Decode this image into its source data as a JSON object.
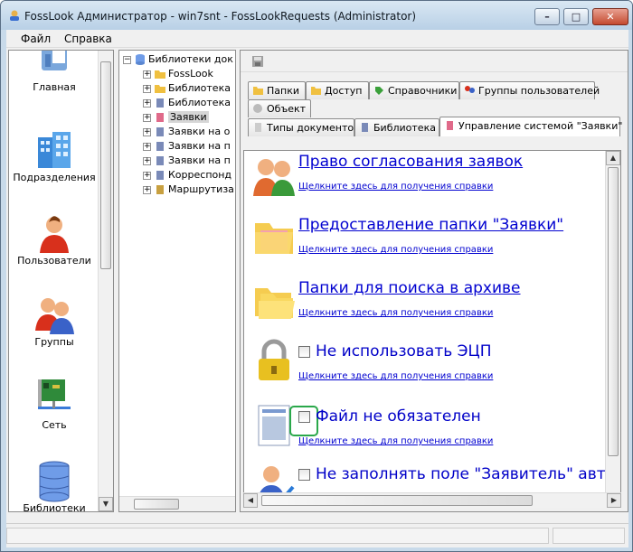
{
  "window": {
    "title": "FossLook Администратор - win7snt - FossLookRequests (Administrator)",
    "minimize_label": "–",
    "maximize_label": "□",
    "close_label": "✕"
  },
  "menu": {
    "file": "Файл",
    "help": "Справка"
  },
  "sidebar": {
    "items": [
      {
        "label": "Главная",
        "icon": "home-icon"
      },
      {
        "label": "Подразделения",
        "icon": "building-icon"
      },
      {
        "label": "Пользователи",
        "icon": "user-icon"
      },
      {
        "label": "Группы",
        "icon": "group-icon"
      },
      {
        "label": "Сеть",
        "icon": "network-icon"
      },
      {
        "label": "Библиотеки документов",
        "icon": "database-icon"
      }
    ]
  },
  "tree": {
    "root": "Библиотеки док",
    "nodes": [
      {
        "label": "FossLook"
      },
      {
        "label": "Библиотека"
      },
      {
        "label": "Библиотека"
      },
      {
        "label": "Заявки",
        "selected": true
      },
      {
        "label": "Заявки на о"
      },
      {
        "label": "Заявки на п"
      },
      {
        "label": "Заявки на п"
      },
      {
        "label": "Корреспонд"
      },
      {
        "label": "Маршрутиза"
      }
    ]
  },
  "tabs": {
    "row1": [
      "Папки",
      "Доступ",
      "Справочники",
      "Группы пользователей"
    ],
    "row2": [
      "Объект"
    ],
    "row3": [
      "Типы документов",
      "Библиотека",
      "Управление системой \"Заявки\""
    ]
  },
  "content": {
    "help_text": "Щелкните здесь для получения справки",
    "entries": [
      {
        "title": "Право согласования заявок",
        "type": "link",
        "icon": "approval-users-icon"
      },
      {
        "title": "Предоставление папки \"Заявки\"",
        "type": "link",
        "icon": "folder-share-icon"
      },
      {
        "title": "Папки для поиска в архиве",
        "type": "link",
        "icon": "folders-icon"
      },
      {
        "title": "Не использовать ЭЦП",
        "type": "checkbox",
        "checked": false,
        "icon": "lock-icon"
      },
      {
        "title": "Файл не обязателен",
        "type": "checkbox",
        "checked": false,
        "icon": "document-icon"
      },
      {
        "title": "Не заполнять поле \"Заявитель\" авто",
        "type": "checkbox",
        "checked": false,
        "icon": "user-check-icon"
      }
    ]
  }
}
